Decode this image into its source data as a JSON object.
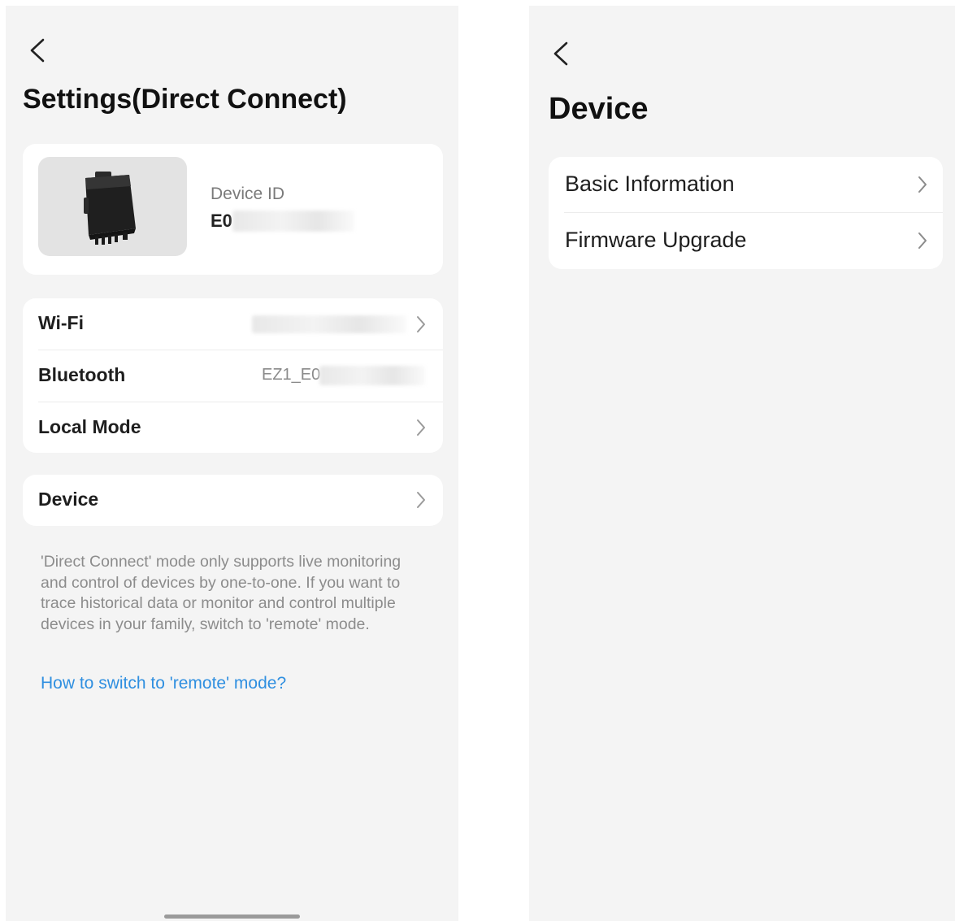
{
  "settings_screen": {
    "title": "Settings(Direct Connect)",
    "device_card": {
      "id_label": "Device ID",
      "id_value": "E0"
    },
    "network": {
      "items": [
        {
          "label": "Wi-Fi",
          "value": ""
        },
        {
          "label": "Bluetooth",
          "value": "EZ1_E0"
        },
        {
          "label": "Local Mode",
          "value": ""
        }
      ]
    },
    "device_item": {
      "label": "Device"
    },
    "note": "'Direct Connect' mode only supports live monitoring and control of devices by one-to-one. If you want to trace historical data or monitor and control multiple devices in your family, switch to 'remote' mode.",
    "help_link": "How to switch to 'remote' mode?"
  },
  "device_screen": {
    "title": "Device",
    "menu": [
      {
        "label": "Basic Information"
      },
      {
        "label": "Firmware Upgrade"
      }
    ]
  },
  "colors": {
    "screen_background": "#f4f4f4",
    "card_background": "#ffffff",
    "link": "#2f8fe0",
    "secondary_text": "#8c8c8c"
  }
}
